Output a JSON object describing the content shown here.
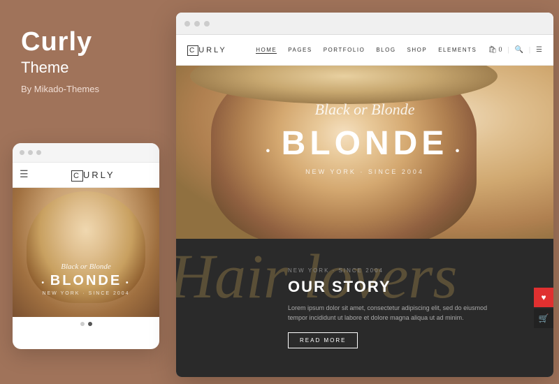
{
  "brand": {
    "title": "Curly",
    "subtitle": "Theme",
    "by": "By Mikado-Themes"
  },
  "mobile_preview": {
    "dots": [
      "dot1",
      "dot2",
      "dot3"
    ],
    "logo": "CURLY",
    "hero_script": "Black or Blonde",
    "hero_main": "BLONDE",
    "hero_since": "NEW YORK · SINCE 2004",
    "nav_dots": [
      {
        "active": false
      },
      {
        "active": true
      }
    ]
  },
  "browser": {
    "window_dots": [
      "dot1",
      "dot2",
      "dot3"
    ],
    "nav": {
      "logo": "CURLY",
      "links": [
        "HOME",
        "PAGES",
        "PORTFOLIO",
        "BLOG",
        "SHOP",
        "ELEMENTS"
      ],
      "active_link": "HOME"
    },
    "hero": {
      "script": "Black or Blonde",
      "main": "BLONDE",
      "since": "NEW YORK · SINCE 2004"
    },
    "story": {
      "sub": "NEW YORK · SINCE 2004",
      "title": "OUR STORY",
      "body": "Lorem ipsum dolor sit amet, consectetur adipiscing elit, sed do eiusmod tempor incididunt ut labore et dolore magna aliqua ut ad minim.",
      "button": "READ MORE",
      "bg_script": "Hair lovers"
    }
  },
  "floating": {
    "btn1": "♥",
    "btn2": "🛒"
  }
}
